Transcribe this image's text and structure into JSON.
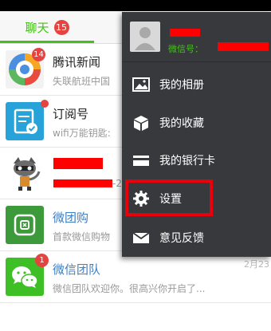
{
  "tabs": {
    "chat": {
      "label": "聊天",
      "badge": "15"
    }
  },
  "chats": [
    {
      "name": "腾讯新闻",
      "preview": "失联航班中国",
      "badge": "14"
    },
    {
      "name": "订阅号",
      "preview": "wifi万能钥匙:"
    },
    {
      "name": "",
      "preview": "-2"
    },
    {
      "name": "微团购",
      "preview": "首款微信购物"
    },
    {
      "name": "微信团队",
      "preview": "微信团队欢迎你。很高兴你开启了...",
      "badge": "1",
      "date": "2月23"
    }
  ],
  "menu": {
    "profile": {
      "wechat_id_label": "微信号："
    },
    "items": [
      {
        "label": "我的相册",
        "icon": "photo-album-icon"
      },
      {
        "label": "我的收藏",
        "icon": "favorites-box-icon"
      },
      {
        "label": "我的银行卡",
        "icon": "bank-card-icon"
      },
      {
        "label": "设置",
        "icon": "gear-icon"
      },
      {
        "label": "意见反馈",
        "icon": "envelope-icon"
      }
    ]
  },
  "colors": {
    "accent": "#45c01a",
    "badge": "#e64340",
    "menu_bg": "#38393d",
    "highlight": "#e8000b"
  }
}
